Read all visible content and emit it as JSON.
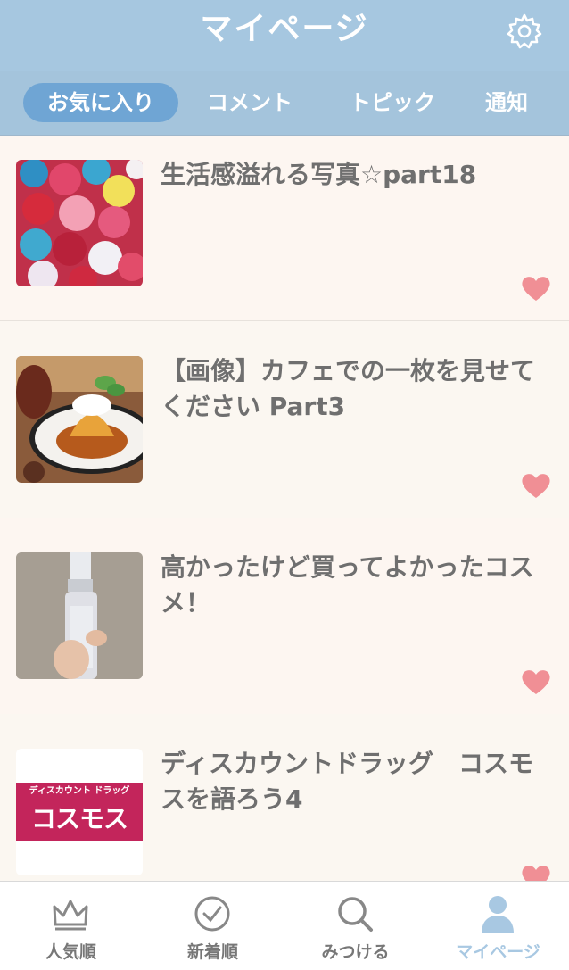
{
  "header": {
    "title": "マイページ",
    "icon": "gear-icon"
  },
  "tabs": [
    {
      "label": "お気に入り",
      "active": true
    },
    {
      "label": "コメント",
      "active": false
    },
    {
      "label": "トピック",
      "active": false
    },
    {
      "label": "通知",
      "active": false
    }
  ],
  "items": [
    {
      "title": "生活感溢れる写真☆part18",
      "thumb": "flowers"
    },
    {
      "title": "【画像】カフェでの一枚を見せてください Part3",
      "thumb": "pudding"
    },
    {
      "title": "高かったけど買ってよかったコスメ！",
      "thumb": "bottle"
    },
    {
      "title": "ディスカウントドラッグ　コスモスを語ろう4",
      "thumb": "logo",
      "logo_small": "ディスカウント ドラッグ",
      "logo_big": "コスモス"
    }
  ],
  "nav": [
    {
      "label": "人気順",
      "icon": "crown-icon"
    },
    {
      "label": "新着順",
      "icon": "clock-icon"
    },
    {
      "label": "みつける",
      "icon": "search-icon"
    },
    {
      "label": "マイページ",
      "icon": "person-icon",
      "active": true
    }
  ],
  "colors": {
    "header": "#a6c7e0",
    "active_tab": "#6fa5d4",
    "heart": "#f08f95",
    "title_text": "#6f6f6f"
  }
}
